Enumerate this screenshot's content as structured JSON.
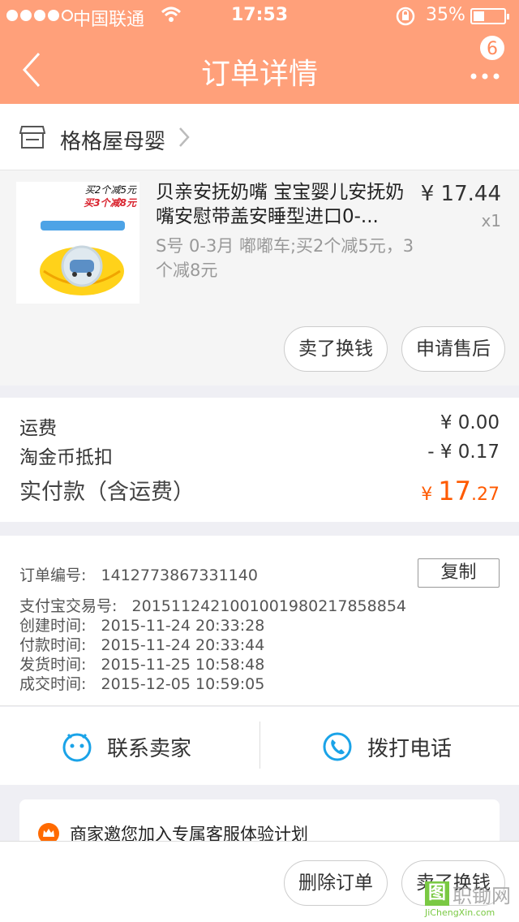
{
  "status_bar": {
    "carrier": "中国联通",
    "time": "17:53",
    "battery_percent": "35%",
    "signal_bars_filled": 4,
    "signal_bars_total": 5,
    "wifi_icon": "wifi-icon",
    "lock_icon": "rotation-lock-icon",
    "battery_level": 0.35
  },
  "nav": {
    "title": "订单详情",
    "back_icon": "back-arrow-icon",
    "more_icon": "more-dots-icon",
    "badge_count": "6",
    "color": "#ffa07a"
  },
  "shop": {
    "name": "格格屋母婴",
    "icon": "store-icon"
  },
  "product": {
    "title": "贝亲安抚奶嘴 宝宝婴儿安抚奶嘴安慰带盖安睡型进口0-...",
    "sku": "S号 0-3月 嘟嘟车;买2个减5元，3个减8元",
    "price": "¥ 17.44",
    "quantity": "x1",
    "image_promo_line1": "买2个减5元",
    "image_promo_line2": "买3个减8元",
    "buttons": {
      "sell": "卖了换钱",
      "after_sale": "申请售后"
    }
  },
  "costs": {
    "shipping_label": "运费",
    "shipping_value": "¥ 0.00",
    "coin_label": "淘金币抵扣",
    "coin_value": "- ¥ 0.17",
    "paid_label": "实付款（含运费）",
    "paid_currency": "¥ ",
    "paid_integer": "17",
    "paid_decimal": ".27",
    "accent_color": "#ff5a00"
  },
  "order_info": {
    "order_no": "订单编号:   1412773867331140",
    "alipay_no": "支付宝交易号:   2015112421001001980217858854",
    "created": "创建时间:   2015-11-24 20:33:28",
    "paid": "付款时间:   2015-11-24 20:33:44",
    "shipped": "发货时间:   2015-11-25 10:58:48",
    "completed": "成交时间:   2015-12-05 10:59:05",
    "copy_button": "复制"
  },
  "contact": {
    "seller": "联系卖家",
    "phone": "拨打电话",
    "seller_icon": "chat-face-icon",
    "phone_icon": "phone-icon"
  },
  "invite": {
    "text": "商家邀您加入专属客服体验计划",
    "icon": "crown-icon"
  },
  "bottom_bar": {
    "delete": "删除订单",
    "sell": "卖了换钱"
  },
  "watermark": {
    "mark": "图",
    "name": "职锄网",
    "url": "JiChengXin.com"
  }
}
